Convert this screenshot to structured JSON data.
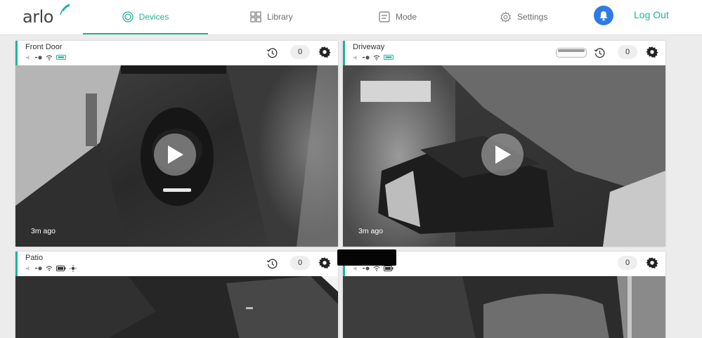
{
  "brand": {
    "name": "arlo",
    "accent": "#1fb59a"
  },
  "nav": {
    "devices": "Devices",
    "library": "Library",
    "mode": "Mode",
    "settings": "Settings",
    "logout": "Log Out"
  },
  "cameras": [
    {
      "name": "Front Door",
      "count": "0",
      "last_activity": "3m ago",
      "power_source": "PoE"
    },
    {
      "name": "Driveway",
      "count": "0",
      "last_activity": "3m ago",
      "power_source": "PoE"
    },
    {
      "name": "Patio",
      "count": "0",
      "power_source": "battery"
    },
    {
      "name": "",
      "count": "0",
      "power_source": "battery"
    }
  ]
}
